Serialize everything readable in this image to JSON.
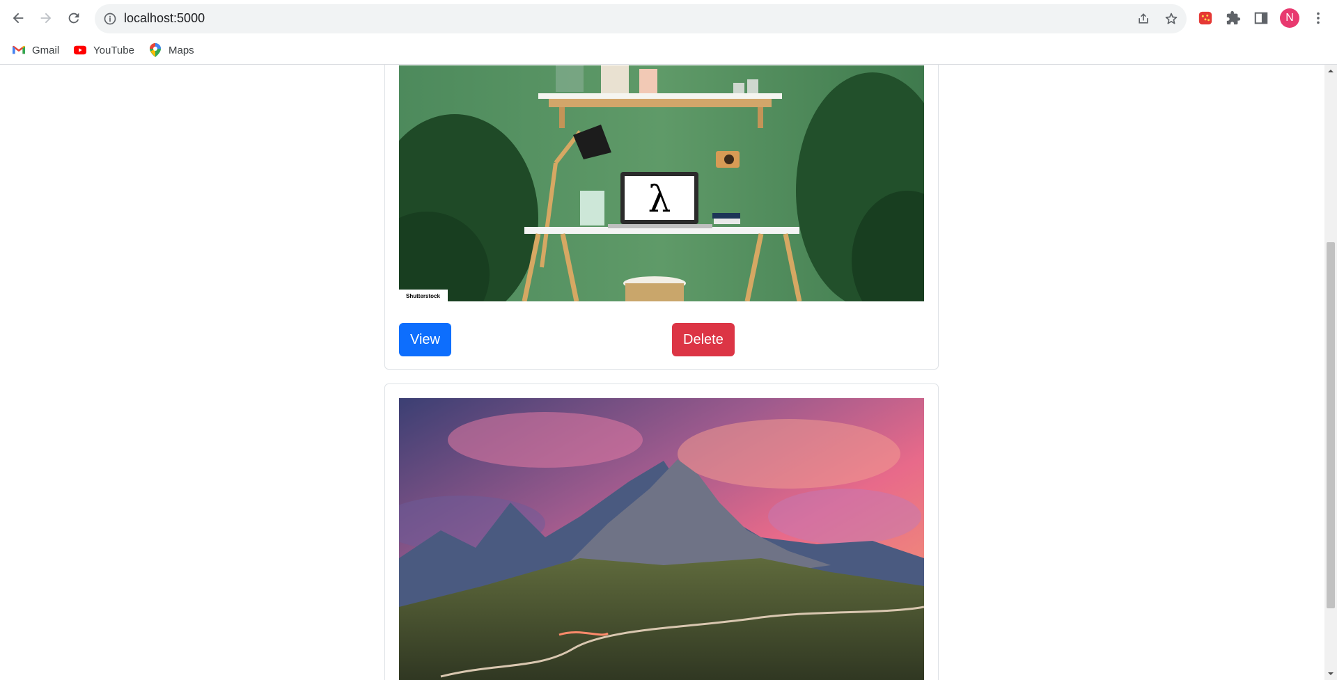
{
  "browser": {
    "url": "localhost:5000",
    "profile_initial": "N",
    "bookmarks": [
      {
        "label": "Gmail",
        "icon": "gmail-icon"
      },
      {
        "label": "YouTube",
        "icon": "youtube-icon"
      },
      {
        "label": "Maps",
        "icon": "maps-icon"
      }
    ]
  },
  "cards": [
    {
      "image_name": "office-desk-image",
      "watermark": "Shutterstock",
      "screen_glyph": "λ",
      "view_label": "View",
      "delete_label": "Delete"
    },
    {
      "image_name": "mountain-sunset-image"
    }
  ],
  "colors": {
    "primary": "#0d6efd",
    "danger": "#dc3545",
    "avatar": "#e8396f"
  }
}
